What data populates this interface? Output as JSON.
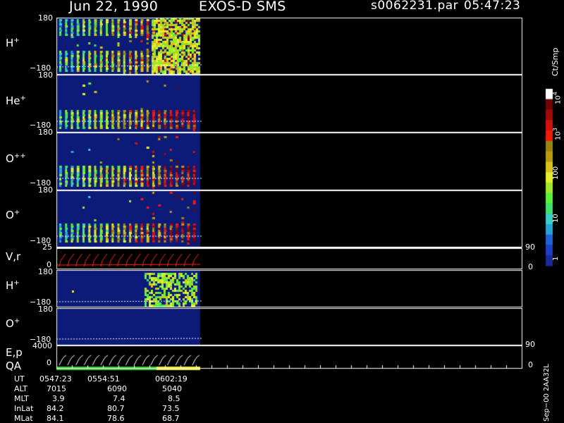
{
  "header": {
    "date": "Jun 22, 1990",
    "instrument": "EXOS-D SMS",
    "file": "s0062231.par",
    "time": "05:47:23"
  },
  "panels": [
    {
      "id": "hplus",
      "base": "H",
      "sup": "+",
      "tick_top": "180",
      "tick_bottom": "−180"
    },
    {
      "id": "heplus",
      "base": "He",
      "sup": "+",
      "tick_top": "180",
      "tick_bottom": "−180"
    },
    {
      "id": "oplusplus",
      "base": "O",
      "sup": "++",
      "tick_top": "180",
      "tick_bottom": "−180"
    },
    {
      "id": "oplus",
      "base": "O",
      "sup": "+",
      "tick_top": "180",
      "tick_bottom": "−180"
    },
    {
      "id": "vr",
      "label": "V,r",
      "tick_top": "25",
      "tick_bottom": "0",
      "right_top": "90",
      "right_bottom": "0"
    },
    {
      "id": "hplus2",
      "base": "H",
      "sup": "+",
      "tick_top": "180",
      "tick_bottom": "−180"
    },
    {
      "id": "oplus2",
      "base": "O",
      "sup": "+",
      "tick_top": "180",
      "tick_bottom": "−180"
    },
    {
      "id": "ep",
      "label1": "E,p",
      "label2": "QA",
      "tick_top": "4000",
      "tick_bottom": "0",
      "right_top": "90",
      "right_bottom": "0"
    }
  ],
  "colorbar": {
    "unit": "Ct/Smp",
    "labels": [
      {
        "base": "10",
        "sup": "4",
        "value": 10000
      },
      {
        "base": "10",
        "sup": "3",
        "value": 1000
      },
      {
        "base": "100",
        "sup": "",
        "value": 100
      },
      {
        "base": "10",
        "sup": "",
        "value": 10
      },
      {
        "base": "1",
        "sup": "",
        "value": 1
      }
    ]
  },
  "footer": {
    "side_text": "Sep−00  2AA32L",
    "rows": [
      {
        "label": "UT",
        "values": [
          "0547:23",
          "0554:51",
          "0602:19"
        ]
      },
      {
        "label": "ALT",
        "values": [
          "7015",
          "6090",
          "5040"
        ]
      },
      {
        "label": "MLT",
        "values": [
          "3.9",
          "7.4",
          "8.5"
        ]
      },
      {
        "label": "InLat",
        "values": [
          "84.2",
          "80.7",
          "73.5"
        ]
      },
      {
        "label": "MLat",
        "values": [
          "84.1",
          "78.6",
          "68.7"
        ]
      }
    ]
  },
  "chart_data": {
    "type": "heatmap",
    "title": "Jun 22, 1990   EXOS-D SMS",
    "colorbar_range": [
      1,
      10000
    ],
    "colorbar_scale": "log",
    "colorbar_unit": "Ct/Smp",
    "x_ticks": [
      "0547:23",
      "0554:51",
      "0602:19"
    ],
    "panels": [
      {
        "label": "H+",
        "ylim": [
          -180,
          180
        ]
      },
      {
        "label": "He+",
        "ylim": [
          -180,
          180
        ]
      },
      {
        "label": "O++",
        "ylim": [
          -180,
          180
        ]
      },
      {
        "label": "O+",
        "ylim": [
          -180,
          180
        ]
      },
      {
        "label": "V,r",
        "ylim": [
          0,
          25
        ],
        "right_ylim": [
          0,
          90
        ]
      },
      {
        "label": "H+",
        "ylim": [
          -180,
          180
        ]
      },
      {
        "label": "O+",
        "ylim": [
          -180,
          180
        ]
      },
      {
        "label": "E,p",
        "ylim": [
          0,
          4000
        ],
        "right_ylim": [
          0,
          90
        ]
      }
    ],
    "quality_bar": {
      "label": "QA",
      "colors": [
        "#3ad13a",
        "#3ad13a",
        "#f0ee32"
      ]
    },
    "colors": {
      "background": "#0c1a78",
      "bar_low": "#1b2bb0",
      "bar_high": "#ff1a00"
    }
  }
}
